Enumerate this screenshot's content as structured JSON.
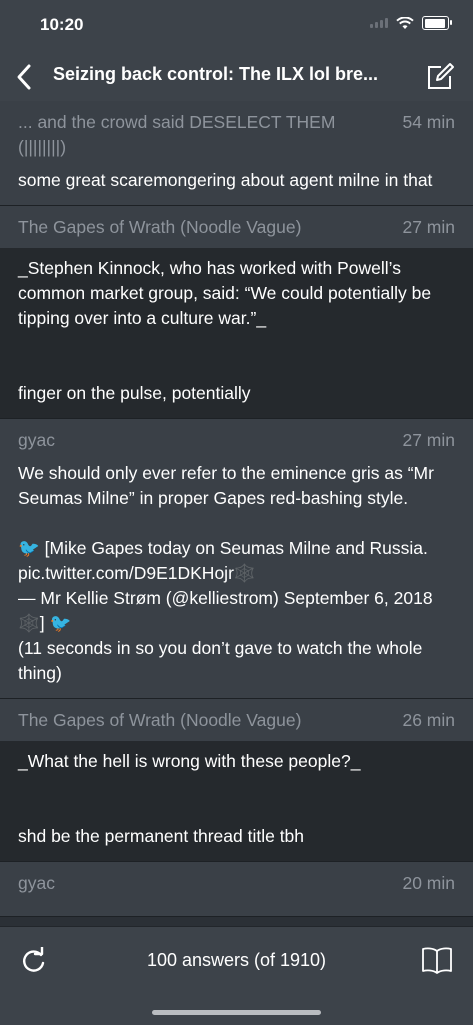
{
  "status": {
    "time": "10:20"
  },
  "nav": {
    "title": "Seizing back control: The ILX lol bre..."
  },
  "posts": [
    {
      "author": "... and the crowd said DESELECT THEM (||||||||)",
      "time": "54 min",
      "body": "some great scaremongering about agent milne in that"
    },
    {
      "author": "The Gapes of Wrath (Noodle Vague)",
      "time": "27 min",
      "body": "_Stephen Kinnock, who has worked with Powell’s common market group, said: “We could potentially be tipping over into a culture war.”_\n\n\nfinger on the pulse, potentially"
    },
    {
      "author": "gyac",
      "time": "27 min",
      "body": "We should only ever refer to the eminence gris as “Mr Seumas Milne” in proper Gapes red-bashing style.\n\n🐦 [Mike Gapes today on Seumas Milne and Russia. pic.twitter.com/D9E1DKHojr🕸️\n— Mr Kellie Strøm (@kelliestrom) September 6, 2018🕸️] 🐦\n(11 seconds in so you don’t gave to watch the whole thing)"
    },
    {
      "author": "The Gapes of Wrath (Noodle Vague)",
      "time": "26 min",
      "body": "_What the hell is wrong with these people?_\n\n\nshd be the permanent thread title tbh"
    },
    {
      "author": "gyac",
      "time": "20 min",
      "body": ""
    }
  ],
  "toolbar": {
    "answers": "100 answers (of 1910)"
  }
}
